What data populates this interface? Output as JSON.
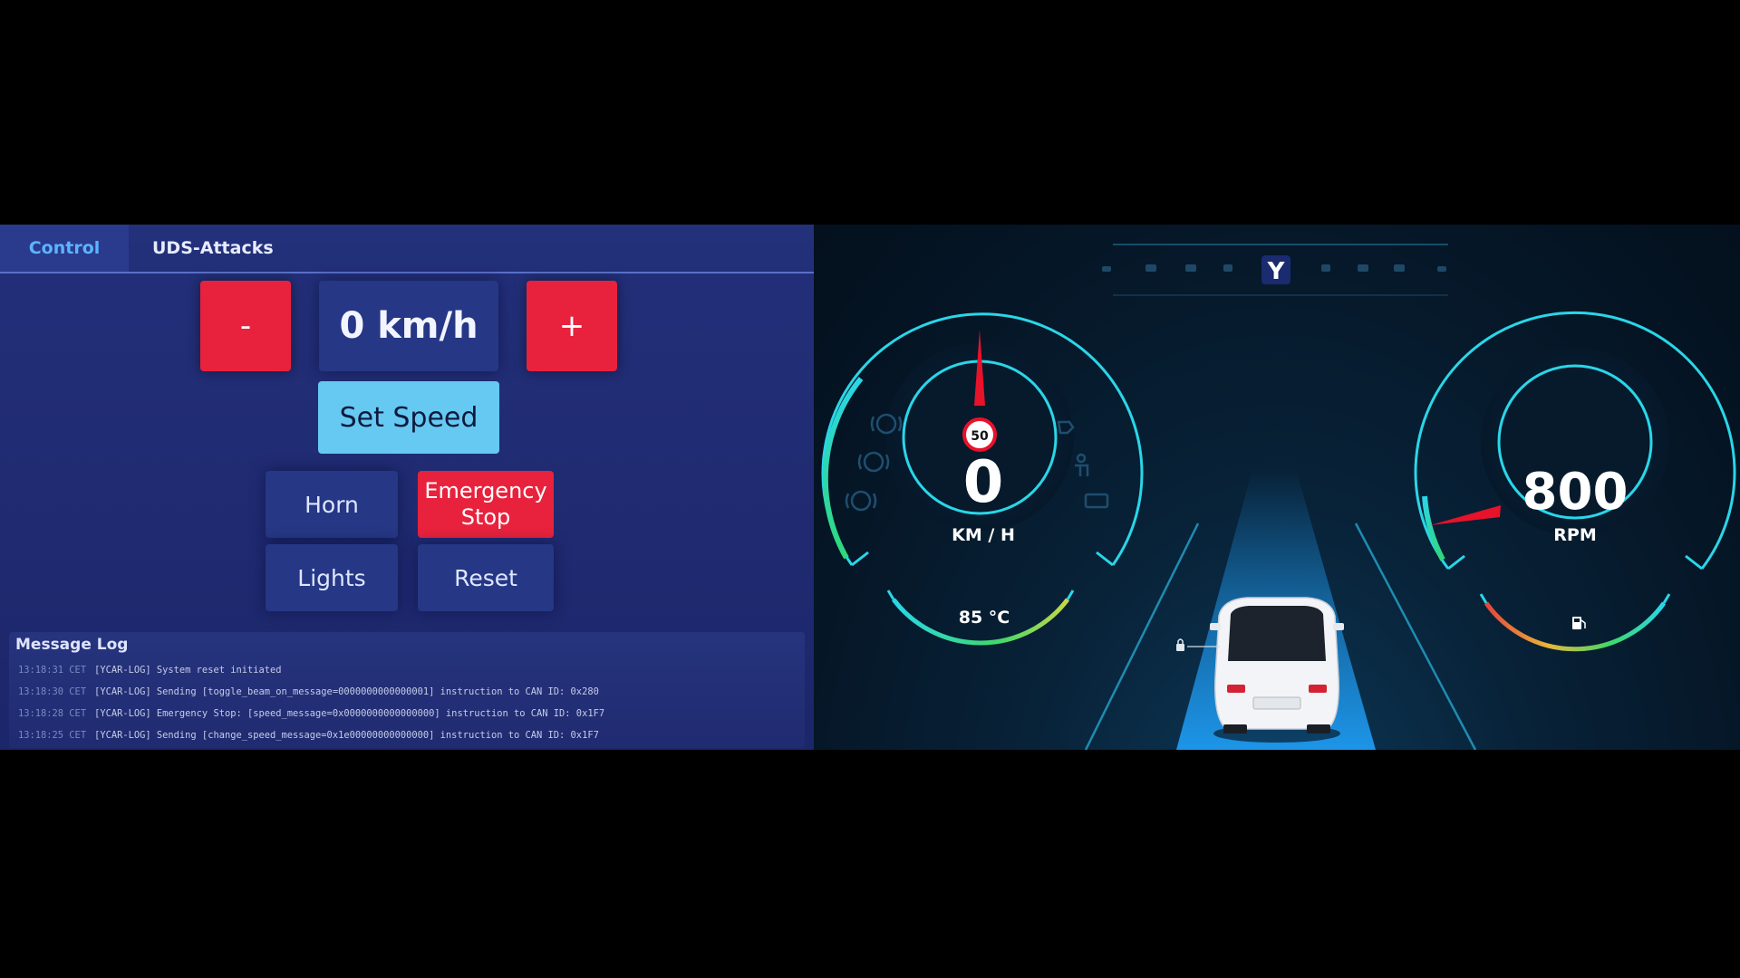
{
  "tabs": {
    "control": "Control",
    "uds_attacks": "UDS-Attacks",
    "active": "Control"
  },
  "controls": {
    "minus_label": "-",
    "plus_label": "+",
    "speed_display": "0 km/h",
    "set_speed_label": "Set Speed",
    "horn_label": "Horn",
    "emergency_stop_label": "Emergency Stop",
    "lights_label": "Lights",
    "reset_label": "Reset"
  },
  "message_log": {
    "title": "Message Log",
    "entries": [
      {
        "time": "13:18:31 CET",
        "text": "[YCAR-LOG] System reset initiated"
      },
      {
        "time": "13:18:30 CET",
        "text": "[YCAR-LOG] Sending [toggle_beam_on_message=0000000000000001] instruction to CAN ID: 0x280"
      },
      {
        "time": "13:18:28 CET",
        "text": "[YCAR-LOG] Emergency Stop: [speed_message=0x0000000000000000] instruction to CAN ID: 0x1F7"
      },
      {
        "time": "13:18:25 CET",
        "text": "[YCAR-LOG] Sending [change_speed_message=0x1e00000000000000] instruction to CAN ID: 0x1F7"
      }
    ]
  },
  "dashboard": {
    "speed_value": "0",
    "speed_unit": "KM / H",
    "speed_limit": "50",
    "temperature": "85 °C",
    "rpm_value": "800",
    "rpm_unit": "RPM",
    "logo_letter": "Y",
    "icons": [
      "brake-warning-icon",
      "brake-system-icon",
      "tire-pressure-icon",
      "oil-pressure-icon",
      "seatbelt-icon",
      "battery-icon",
      "fuel-pump-icon",
      "lock-icon",
      "car-icon"
    ],
    "colors": {
      "accent": "#2ad6e8",
      "needle": "#e8122a",
      "speed_limit_ring": "#e8122a",
      "road_beam": "#1c8fe0"
    }
  }
}
